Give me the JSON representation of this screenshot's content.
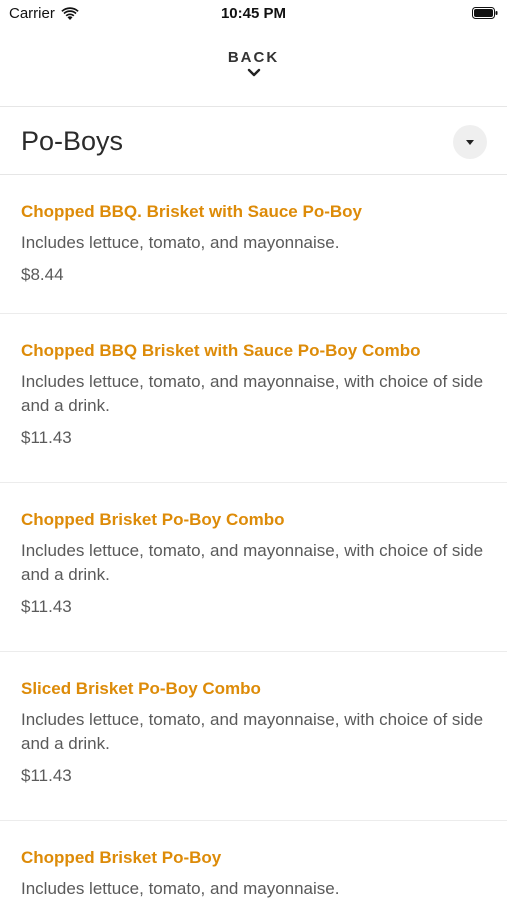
{
  "status_bar": {
    "carrier": "Carrier",
    "time": "10:45 PM"
  },
  "nav": {
    "back_label": "BACK"
  },
  "section": {
    "title": "Po-Boys"
  },
  "colors": {
    "accent": "#dd8b08",
    "text_secondary": "#5a5a5a"
  },
  "items": [
    {
      "name": "Chopped BBQ. Brisket with Sauce Po-Boy",
      "description": "Includes lettuce, tomato, and mayonnaise.",
      "price": "$8.44"
    },
    {
      "name": "Chopped BBQ Brisket with Sauce Po-Boy Combo",
      "description": "Includes lettuce, tomato, and mayonnaise, with choice of side and a drink.",
      "price": "$11.43"
    },
    {
      "name": "Chopped Brisket Po-Boy Combo",
      "description": "Includes lettuce, tomato, and mayonnaise, with choice of side and a drink.",
      "price": "$11.43"
    },
    {
      "name": "Sliced Brisket Po-Boy Combo",
      "description": "Includes lettuce, tomato, and mayonnaise, with choice of side and a drink.",
      "price": "$11.43"
    },
    {
      "name": "Chopped Brisket Po-Boy",
      "description": "Includes lettuce, tomato, and mayonnaise.",
      "price": ""
    }
  ]
}
